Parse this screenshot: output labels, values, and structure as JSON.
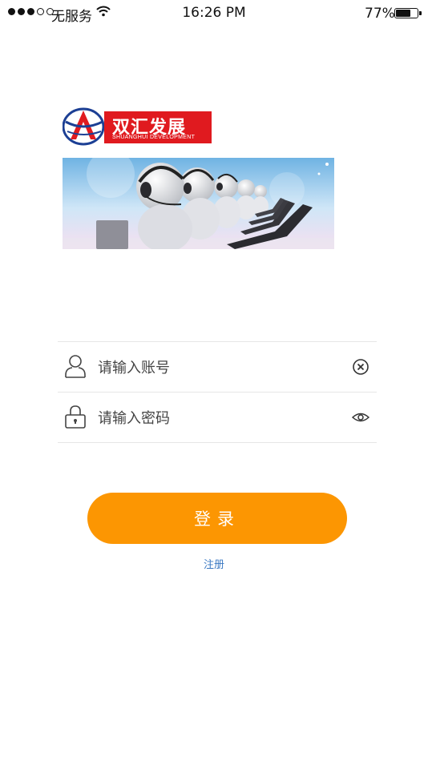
{
  "status_bar": {
    "carrier": "无服务",
    "time": "16:26 PM",
    "battery_percent": "77%",
    "battery_level": 0.77,
    "signal_bars_filled": 3,
    "signal_bars_total": 5
  },
  "logo": {
    "name_cn": "双汇发展",
    "name_en": "SHUANGHUI DEVELOPMENT",
    "brand_color": "#e01a1f"
  },
  "form": {
    "account": {
      "placeholder": "请输入账号",
      "value": "",
      "icon": "user-icon",
      "action_icon": "clear-icon"
    },
    "password": {
      "placeholder": "请输入密码",
      "value": "",
      "icon": "lock-icon",
      "action_icon": "eye-icon"
    }
  },
  "login_button": {
    "label": "登录",
    "color": "#fc9602"
  },
  "register_link": {
    "label": "注册",
    "color": "#3a78c2"
  }
}
